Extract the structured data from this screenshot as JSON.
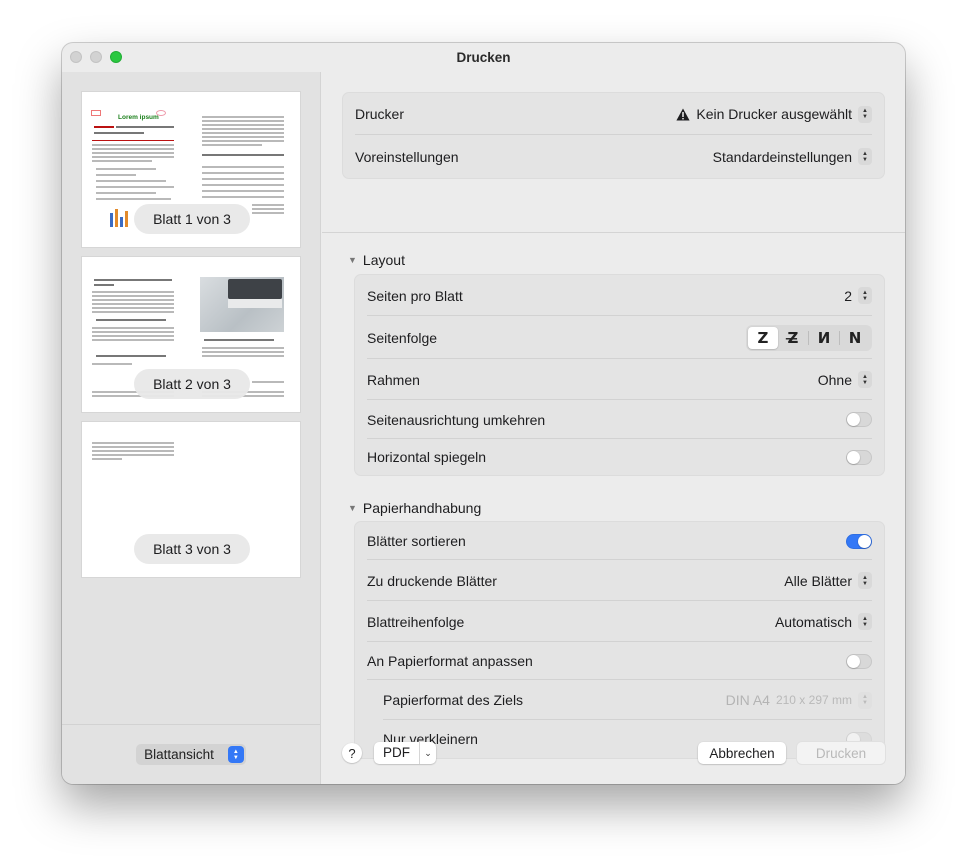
{
  "window": {
    "title": "Drucken"
  },
  "sidebar": {
    "pages": [
      {
        "label": "Blatt 1 von 3",
        "heading": "Lorem ipsum"
      },
      {
        "label": "Blatt 2 von 3"
      },
      {
        "label": "Blatt 3 von 3"
      }
    ],
    "view_select": "Blattansicht"
  },
  "printer": {
    "printer_label": "Drucker",
    "printer_value": "Kein Drucker ausgewählt",
    "presets_label": "Voreinstellungen",
    "presets_value": "Standardeinstellungen"
  },
  "layout": {
    "title": "Layout",
    "pages_per_sheet_label": "Seiten pro Blatt",
    "pages_per_sheet_value": "2",
    "page_order_label": "Seitenfolge",
    "page_order_options": [
      "Z",
      "Z̶",
      "И",
      "N"
    ],
    "border_label": "Rahmen",
    "border_value": "Ohne",
    "reverse_orientation_label": "Seitenausrichtung umkehren",
    "reverse_orientation_on": false,
    "flip_horizontal_label": "Horizontal spiegeln",
    "flip_horizontal_on": false
  },
  "paper_handling": {
    "title": "Papierhandhabung",
    "collate_label": "Blätter sortieren",
    "collate_on": true,
    "pages_to_print_label": "Zu druckende Blätter",
    "pages_to_print_value": "Alle Blätter",
    "page_order_label": "Blattreihenfolge",
    "page_order_value": "Automatisch",
    "scale_to_fit_label": "An Papierformat anpassen",
    "scale_to_fit_on": false,
    "dest_paper_label": "Papierformat des Ziels",
    "dest_paper_value": "DIN A4",
    "dest_paper_dims": "210 x 297 mm",
    "scale_down_only_label": "Nur verkleinern",
    "scale_down_only_on": false
  },
  "footer": {
    "help": "?",
    "pdf": "PDF",
    "cancel": "Abbrechen",
    "print": "Drucken"
  },
  "colors": {
    "accent": "#3478f6",
    "window_bg": "#ececec",
    "sidebar_bg": "#e2e2e2"
  }
}
